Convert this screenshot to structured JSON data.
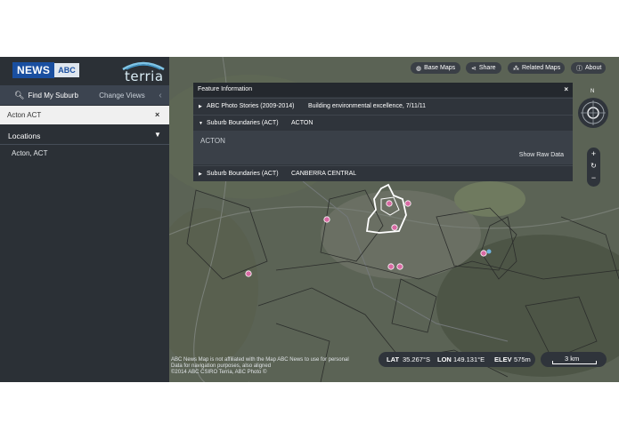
{
  "brand": {
    "news": "NEWS",
    "abc": "ABC",
    "terria": "terria"
  },
  "sidebar": {
    "tab_find": "Find My Suburb",
    "tab_views": "Change Views",
    "search_value": "Acton ACT",
    "clear_symbol": "×",
    "locations_label": "Locations",
    "locations": [
      "Acton, ACT"
    ]
  },
  "toolbar": {
    "base_maps": "Base Maps",
    "share": "Share",
    "related_maps": "Related Maps",
    "about": "About"
  },
  "feature_info": {
    "title": "Feature Information",
    "close": "×",
    "rows": [
      {
        "name": "ABC Photo Stories (2009-2014)",
        "value": "Building environmental excellence, 7/11/11",
        "expanded": false
      },
      {
        "name": "Suburb Boundaries (ACT)",
        "value": "ACTON",
        "expanded": true
      },
      {
        "name": "Suburb Boundaries (ACT)",
        "value": "CANBERRA CENTRAL",
        "expanded": false
      }
    ],
    "expanded_subtitle": "ACTON",
    "show_raw": "Show Raw Data"
  },
  "controls": {
    "north": "N",
    "zoom_in": "+",
    "refresh": "↻",
    "zoom_out": "−"
  },
  "status": {
    "lat_label": "LAT",
    "lat": "35.267°S",
    "lon_label": "LON",
    "lon": "149.131°E",
    "elev_label": "ELEV",
    "elev": "575m",
    "scale": "3 km"
  },
  "attribution": [
    "ABC News Map is not affiliated with the Map ABC News to use for personal",
    "Data for navigation purposes, also aligned",
    "©2014 ABC CSIRO Terria, ABC Photo ©"
  ],
  "colors": {
    "sidebar": "#2b3036",
    "panel": "#2f343b",
    "accent": "#1a4fa0",
    "marker": "#d86aa3"
  }
}
